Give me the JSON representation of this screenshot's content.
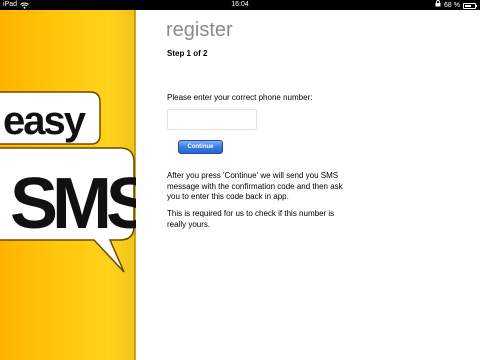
{
  "status_bar": {
    "device": "iPad",
    "time": "16:04",
    "battery_text": "68 %",
    "battery_level": 0.68,
    "icons": [
      "wifi-icon",
      "lock-icon",
      "battery-icon"
    ]
  },
  "brand": {
    "word_top": "easy",
    "word_bottom": "SMS",
    "background_color": "#ffc80c",
    "bubble_color": "#ffffff",
    "text_color": "#111111"
  },
  "page": {
    "title": "register",
    "step": "Step 1 of 2",
    "phone_prompt": "Please enter your correct phone number:",
    "phone_value": "",
    "phone_placeholder": "",
    "continue_label": "Continue",
    "info_paragraph_1": "After you press 'Continue' we will send you SMS message with the confirmation code and then ask you to enter this code back in app.",
    "info_paragraph_2": "This is required for us to check if this number is really yours."
  }
}
